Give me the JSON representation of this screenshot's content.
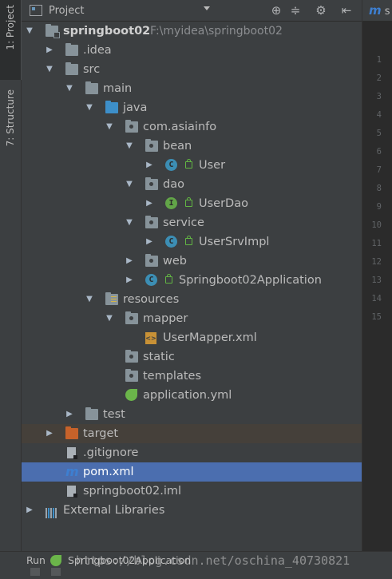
{
  "side_tabs": {
    "project": "1: Project",
    "structure": "7: Structure"
  },
  "header": {
    "title": "Project",
    "tools": [
      "target-icon",
      "collapse-icon",
      "gear-icon",
      "hide-icon"
    ]
  },
  "tree": {
    "root": {
      "name": "springboot02",
      "path": "F:\\myidea\\springboot02"
    },
    "idea": ".idea",
    "src": "src",
    "main": "main",
    "java": "java",
    "package": "com.asiainfo",
    "bean": "bean",
    "user": "User",
    "dao": "dao",
    "userdao": "UserDao",
    "service": "service",
    "usersrvimpl": "UserSrvImpl",
    "web": "web",
    "app": "Springboot02Application",
    "resources": "resources",
    "mapper": "mapper",
    "usermapper": "UserMapper.xml",
    "static": "static",
    "templates": "templates",
    "appyml": "application.yml",
    "test": "test",
    "target": "target",
    "gitignore": ".gitignore",
    "pom": "pom.xml",
    "iml": "springboot02.iml",
    "extlibs": "External Libraries"
  },
  "editor": {
    "tab_label": "s",
    "line_numbers": [
      "1",
      "2",
      "3",
      "4",
      "5",
      "6",
      "7",
      "8",
      "9",
      "10",
      "11",
      "12",
      "13",
      "14",
      "15"
    ]
  },
  "bottom": {
    "run_label": "Run",
    "run_app": "Springboot02Application",
    "watermark": "https://blog.csdn.net/oschina_40730821"
  },
  "colors": {
    "selection": "#4b6eaf",
    "panel_bg": "#3c3f41",
    "excluded": "#45403a"
  }
}
